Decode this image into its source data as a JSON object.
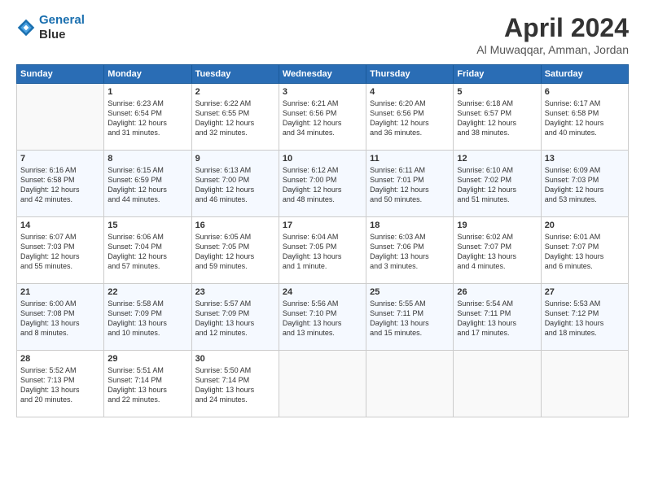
{
  "header": {
    "logo_line1": "General",
    "logo_line2": "Blue",
    "title": "April 2024",
    "subtitle": "Al Muwaqqar, Amman, Jordan"
  },
  "columns": [
    "Sunday",
    "Monday",
    "Tuesday",
    "Wednesday",
    "Thursday",
    "Friday",
    "Saturday"
  ],
  "weeks": [
    [
      {
        "day": "",
        "info": ""
      },
      {
        "day": "1",
        "info": "Sunrise: 6:23 AM\nSunset: 6:54 PM\nDaylight: 12 hours\nand 31 minutes."
      },
      {
        "day": "2",
        "info": "Sunrise: 6:22 AM\nSunset: 6:55 PM\nDaylight: 12 hours\nand 32 minutes."
      },
      {
        "day": "3",
        "info": "Sunrise: 6:21 AM\nSunset: 6:56 PM\nDaylight: 12 hours\nand 34 minutes."
      },
      {
        "day": "4",
        "info": "Sunrise: 6:20 AM\nSunset: 6:56 PM\nDaylight: 12 hours\nand 36 minutes."
      },
      {
        "day": "5",
        "info": "Sunrise: 6:18 AM\nSunset: 6:57 PM\nDaylight: 12 hours\nand 38 minutes."
      },
      {
        "day": "6",
        "info": "Sunrise: 6:17 AM\nSunset: 6:58 PM\nDaylight: 12 hours\nand 40 minutes."
      }
    ],
    [
      {
        "day": "7",
        "info": "Sunrise: 6:16 AM\nSunset: 6:58 PM\nDaylight: 12 hours\nand 42 minutes."
      },
      {
        "day": "8",
        "info": "Sunrise: 6:15 AM\nSunset: 6:59 PM\nDaylight: 12 hours\nand 44 minutes."
      },
      {
        "day": "9",
        "info": "Sunrise: 6:13 AM\nSunset: 7:00 PM\nDaylight: 12 hours\nand 46 minutes."
      },
      {
        "day": "10",
        "info": "Sunrise: 6:12 AM\nSunset: 7:00 PM\nDaylight: 12 hours\nand 48 minutes."
      },
      {
        "day": "11",
        "info": "Sunrise: 6:11 AM\nSunset: 7:01 PM\nDaylight: 12 hours\nand 50 minutes."
      },
      {
        "day": "12",
        "info": "Sunrise: 6:10 AM\nSunset: 7:02 PM\nDaylight: 12 hours\nand 51 minutes."
      },
      {
        "day": "13",
        "info": "Sunrise: 6:09 AM\nSunset: 7:03 PM\nDaylight: 12 hours\nand 53 minutes."
      }
    ],
    [
      {
        "day": "14",
        "info": "Sunrise: 6:07 AM\nSunset: 7:03 PM\nDaylight: 12 hours\nand 55 minutes."
      },
      {
        "day": "15",
        "info": "Sunrise: 6:06 AM\nSunset: 7:04 PM\nDaylight: 12 hours\nand 57 minutes."
      },
      {
        "day": "16",
        "info": "Sunrise: 6:05 AM\nSunset: 7:05 PM\nDaylight: 12 hours\nand 59 minutes."
      },
      {
        "day": "17",
        "info": "Sunrise: 6:04 AM\nSunset: 7:05 PM\nDaylight: 13 hours\nand 1 minute."
      },
      {
        "day": "18",
        "info": "Sunrise: 6:03 AM\nSunset: 7:06 PM\nDaylight: 13 hours\nand 3 minutes."
      },
      {
        "day": "19",
        "info": "Sunrise: 6:02 AM\nSunset: 7:07 PM\nDaylight: 13 hours\nand 4 minutes."
      },
      {
        "day": "20",
        "info": "Sunrise: 6:01 AM\nSunset: 7:07 PM\nDaylight: 13 hours\nand 6 minutes."
      }
    ],
    [
      {
        "day": "21",
        "info": "Sunrise: 6:00 AM\nSunset: 7:08 PM\nDaylight: 13 hours\nand 8 minutes."
      },
      {
        "day": "22",
        "info": "Sunrise: 5:58 AM\nSunset: 7:09 PM\nDaylight: 13 hours\nand 10 minutes."
      },
      {
        "day": "23",
        "info": "Sunrise: 5:57 AM\nSunset: 7:09 PM\nDaylight: 13 hours\nand 12 minutes."
      },
      {
        "day": "24",
        "info": "Sunrise: 5:56 AM\nSunset: 7:10 PM\nDaylight: 13 hours\nand 13 minutes."
      },
      {
        "day": "25",
        "info": "Sunrise: 5:55 AM\nSunset: 7:11 PM\nDaylight: 13 hours\nand 15 minutes."
      },
      {
        "day": "26",
        "info": "Sunrise: 5:54 AM\nSunset: 7:11 PM\nDaylight: 13 hours\nand 17 minutes."
      },
      {
        "day": "27",
        "info": "Sunrise: 5:53 AM\nSunset: 7:12 PM\nDaylight: 13 hours\nand 18 minutes."
      }
    ],
    [
      {
        "day": "28",
        "info": "Sunrise: 5:52 AM\nSunset: 7:13 PM\nDaylight: 13 hours\nand 20 minutes."
      },
      {
        "day": "29",
        "info": "Sunrise: 5:51 AM\nSunset: 7:14 PM\nDaylight: 13 hours\nand 22 minutes."
      },
      {
        "day": "30",
        "info": "Sunrise: 5:50 AM\nSunset: 7:14 PM\nDaylight: 13 hours\nand 24 minutes."
      },
      {
        "day": "",
        "info": ""
      },
      {
        "day": "",
        "info": ""
      },
      {
        "day": "",
        "info": ""
      },
      {
        "day": "",
        "info": ""
      }
    ]
  ]
}
